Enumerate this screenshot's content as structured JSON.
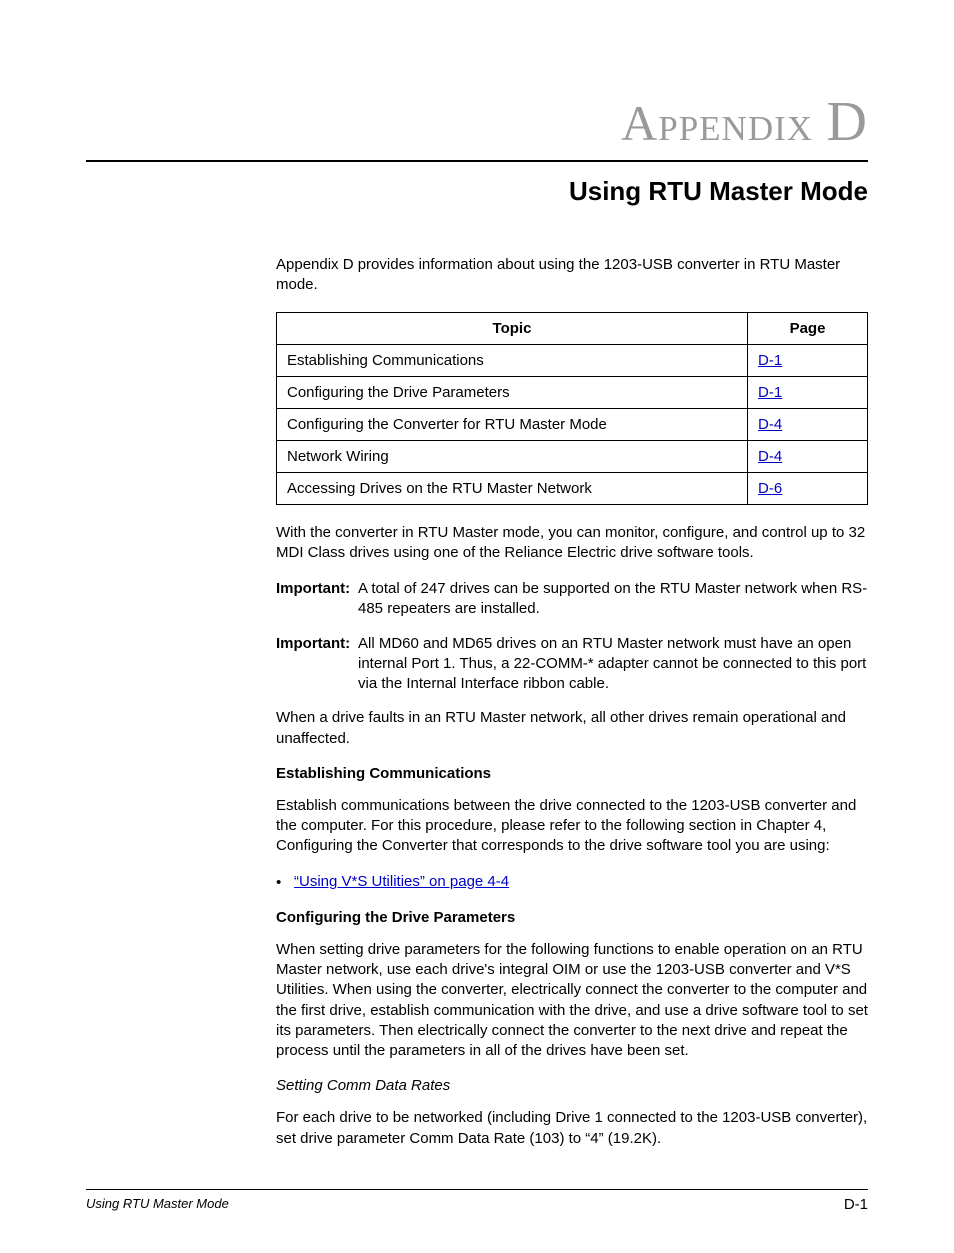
{
  "header": {
    "appendix_word": "Appendix",
    "appendix_letter": "D",
    "subtitle": "Using RTU Master Mode"
  },
  "intro": "Appendix D provides information about using the 1203-USB converter in RTU Master mode.",
  "toc": {
    "head_topic": "Topic",
    "head_page": "Page",
    "rows": [
      {
        "topic": "Establishing Communications",
        "page": "D-1"
      },
      {
        "topic": "Configuring the Drive Parameters",
        "page": "D-1"
      },
      {
        "topic": "Configuring the Converter for RTU Master Mode",
        "page": "D-4"
      },
      {
        "topic": "Network Wiring",
        "page": "D-4"
      },
      {
        "topic": "Accessing Drives on the RTU Master Network",
        "page": "D-6"
      }
    ]
  },
  "para_after_toc": "With the converter in RTU Master mode, you can monitor, configure, and control up to 32 MDI Class drives using one of the Reliance Electric drive software tools.",
  "important_label": "Important:",
  "important1": "A total of 247 drives can be supported on the RTU Master network when RS-485 repeaters are installed.",
  "important2": "All MD60 and MD65 drives on an RTU Master network must have an open internal Port 1. Thus, a 22-COMM-* adapter cannot be connected to this port via the Internal Interface ribbon cable.",
  "para_fault": "When a drive faults in an RTU Master network, all other drives remain operational and unaffected.",
  "sec_estab_head": "Establishing Communications",
  "sec_estab_body": "Establish communications between the drive connected to the 1203-USB converter and the computer. For this procedure, please refer to the following section in Chapter 4, Configuring the Converter that corresponds to the drive software tool you are using:",
  "bullet_link": "“Using V*S Utilities” on page 4-4",
  "sec_conf_head": "Configuring the Drive Parameters",
  "sec_conf_body": "When setting drive parameters for the following functions to enable operation on an RTU Master network, use each drive's integral OIM or use the 1203-USB converter and V*S Utilities. When using the converter, electrically connect the converter to the computer and the first drive, establish communication with the drive, and use a drive software tool to set its parameters. Then electrically connect the converter to the next drive and repeat the process until the parameters in all of the drives have been set.",
  "sec_rate_head": "Setting Comm Data Rates",
  "sec_rate_body": "For each drive to be networked (including Drive 1 connected to the 1203-USB converter), set drive parameter Comm Data Rate (103) to “4” (19.2K).",
  "footer": {
    "left": "Using RTU Master Mode",
    "right": "D-1"
  }
}
